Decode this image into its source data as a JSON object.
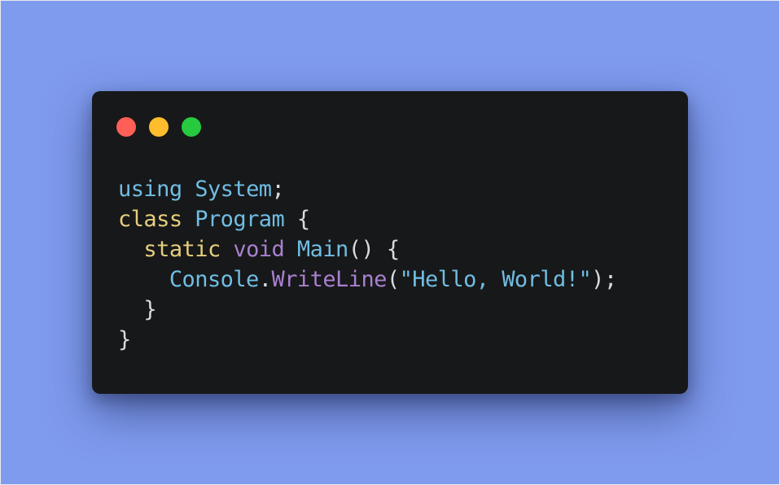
{
  "window": {
    "controls": {
      "close_color": "#ff5f56",
      "minimize_color": "#ffbd2e",
      "maximize_color": "#27c93f"
    }
  },
  "code": {
    "line1": {
      "kw": "using",
      "ns": "System",
      "end": ";"
    },
    "line2": {
      "kw": "class",
      "name": "Program",
      "brace": "{"
    },
    "line3": {
      "indent": "  ",
      "static": "static",
      "void": "void",
      "method": "Main",
      "parens": "()",
      "brace": "{"
    },
    "line4": {
      "indent": "    ",
      "obj": "Console",
      "dot": ".",
      "method": "WriteLine",
      "open": "(",
      "string": "\"Hello, World!\"",
      "close": ");"
    },
    "line5": {
      "indent": "  ",
      "brace": "}"
    },
    "line6": {
      "brace": "}"
    }
  }
}
